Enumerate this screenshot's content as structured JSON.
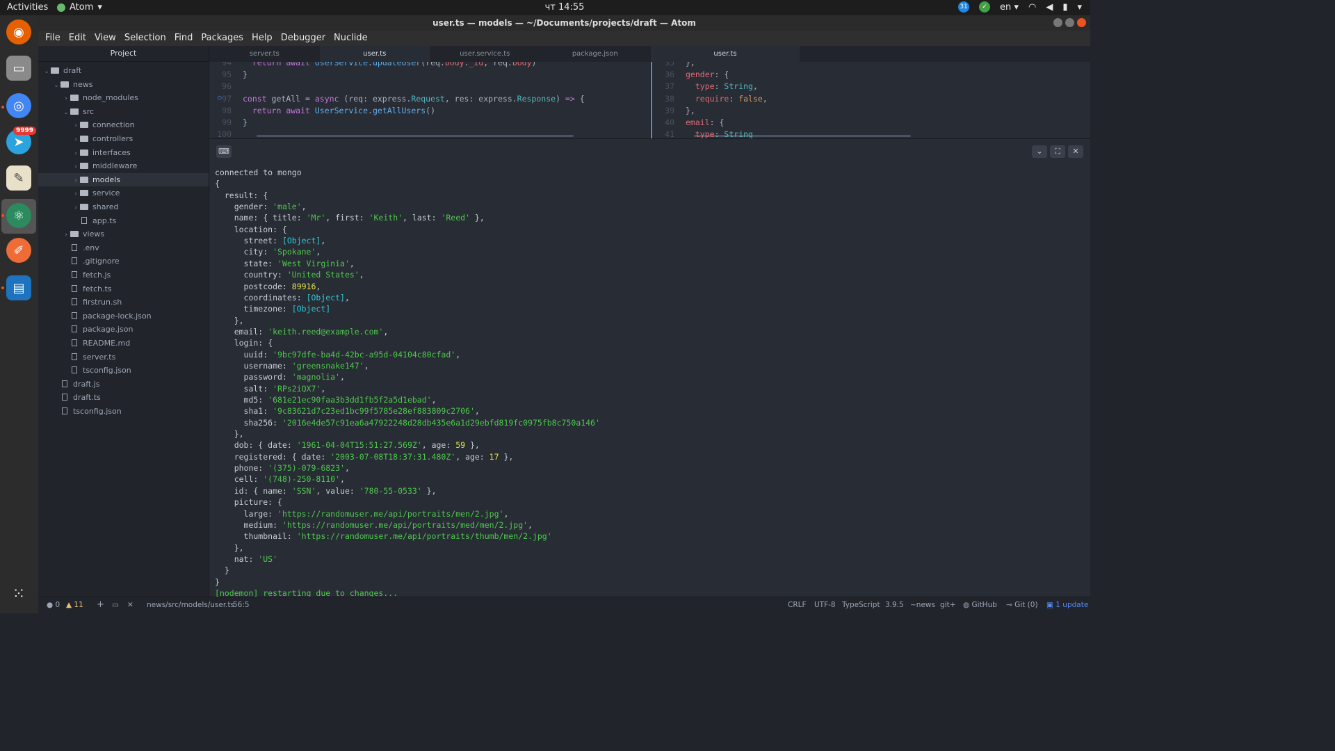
{
  "topbar": {
    "activities": "Activities",
    "app_name": "Atom",
    "app_arrow": "▾",
    "clock": "чт 14:55",
    "lang": "en",
    "lang_arrow": "▾",
    "notify_count": "31"
  },
  "window": {
    "title": "user.ts — models — ~/Documents/projects/draft — Atom"
  },
  "menu": [
    "File",
    "Edit",
    "View",
    "Selection",
    "Find",
    "Packages",
    "Help",
    "Debugger",
    "Nuclide"
  ],
  "dock": {
    "telegram_badge": "9999",
    "icons": [
      "firefox-icon",
      "files-icon",
      "chrome-icon",
      "telegram-icon",
      "text-editor-icon",
      "atom-icon",
      "postman-icon",
      "writer-icon",
      "app-grid-icon"
    ]
  },
  "tree": {
    "header": "Project",
    "rows": [
      {
        "label": "draft",
        "depth": 0,
        "kind": "folder",
        "open": true
      },
      {
        "label": "news",
        "depth": 1,
        "kind": "folder",
        "open": true
      },
      {
        "label": "node_modules",
        "depth": 2,
        "kind": "folder",
        "open": false
      },
      {
        "label": "src",
        "depth": 2,
        "kind": "folder",
        "open": true
      },
      {
        "label": "connection",
        "depth": 3,
        "kind": "folder",
        "open": false
      },
      {
        "label": "controllers",
        "depth": 3,
        "kind": "folder",
        "open": false
      },
      {
        "label": "interfaces",
        "depth": 3,
        "kind": "folder",
        "open": false
      },
      {
        "label": "middleware",
        "depth": 3,
        "kind": "folder",
        "open": false
      },
      {
        "label": "models",
        "depth": 3,
        "kind": "folder",
        "open": false,
        "selected": true
      },
      {
        "label": "service",
        "depth": 3,
        "kind": "folder",
        "open": false
      },
      {
        "label": "shared",
        "depth": 3,
        "kind": "folder",
        "open": false
      },
      {
        "label": "app.ts",
        "depth": 3,
        "kind": "file"
      },
      {
        "label": "views",
        "depth": 2,
        "kind": "folder",
        "open": false
      },
      {
        "label": ".env",
        "depth": 2,
        "kind": "file"
      },
      {
        "label": ".gitignore",
        "depth": 2,
        "kind": "file"
      },
      {
        "label": "fetch.js",
        "depth": 2,
        "kind": "file"
      },
      {
        "label": "fetch.ts",
        "depth": 2,
        "kind": "file"
      },
      {
        "label": "firstrun.sh",
        "depth": 2,
        "kind": "file"
      },
      {
        "label": "package-lock.json",
        "depth": 2,
        "kind": "file"
      },
      {
        "label": "package.json",
        "depth": 2,
        "kind": "file"
      },
      {
        "label": "README.md",
        "depth": 2,
        "kind": "file"
      },
      {
        "label": "server.ts",
        "depth": 2,
        "kind": "file"
      },
      {
        "label": "tsconfig.json",
        "depth": 2,
        "kind": "file"
      },
      {
        "label": "draft.js",
        "depth": 1,
        "kind": "file"
      },
      {
        "label": "draft.ts",
        "depth": 1,
        "kind": "file"
      },
      {
        "label": "tsconfig.json",
        "depth": 1,
        "kind": "file"
      }
    ]
  },
  "tabs_left": [
    {
      "label": "server.ts",
      "active": false
    },
    {
      "label": "user.ts",
      "active": true
    },
    {
      "label": "user.service.ts",
      "active": false
    },
    {
      "label": "package.json",
      "active": false
    }
  ],
  "tabs_right": [
    {
      "label": "user.ts",
      "active": true
    }
  ],
  "editor_left": [
    {
      "num": "94",
      "parts": [
        [
          "pl",
          "  "
        ],
        [
          "kw",
          "return await "
        ],
        [
          "fn",
          "UserService"
        ],
        [
          "pl",
          "."
        ],
        [
          "fn",
          "updateUser"
        ],
        [
          "pl",
          "(req."
        ],
        [
          "pr",
          "body"
        ],
        [
          "pl",
          "."
        ],
        [
          "pr",
          "_id"
        ],
        [
          "pl",
          ", req."
        ],
        [
          "pr",
          "body"
        ],
        [
          "pl",
          ")"
        ]
      ]
    },
    {
      "num": "95",
      "parts": [
        [
          "pl",
          "}"
        ]
      ]
    },
    {
      "num": "96",
      "parts": []
    },
    {
      "num": "97",
      "parts": [
        [
          "kw",
          "const "
        ],
        [
          "pl",
          "getAll = "
        ],
        [
          "kw",
          "async "
        ],
        [
          "pl",
          "(req: express."
        ],
        [
          "ty",
          "Request"
        ],
        [
          "pl",
          ", res: express."
        ],
        [
          "ty",
          "Response"
        ],
        [
          "pl",
          ") "
        ],
        [
          "kw",
          "=>"
        ],
        [
          "pl",
          " {"
        ]
      ]
    },
    {
      "num": "98",
      "parts": [
        [
          "pl",
          "  "
        ],
        [
          "kw",
          "return await "
        ],
        [
          "fn",
          "UserService"
        ],
        [
          "pl",
          "."
        ],
        [
          "fn",
          "getAllUsers"
        ],
        [
          "pl",
          "()"
        ]
      ]
    },
    {
      "num": "99",
      "parts": [
        [
          "pl",
          "}"
        ]
      ]
    },
    {
      "num": "100",
      "parts": []
    }
  ],
  "editor_right": [
    {
      "num": "35",
      "parts": [
        [
          "pl",
          "},"
        ]
      ]
    },
    {
      "num": "36",
      "parts": [
        [
          "pr",
          "gender"
        ],
        [
          "pl",
          ": {"
        ]
      ]
    },
    {
      "num": "37",
      "parts": [
        [
          "pl",
          "  "
        ],
        [
          "pr",
          "type"
        ],
        [
          "pl",
          ": "
        ],
        [
          "ty",
          "String"
        ],
        [
          "pl",
          ","
        ]
      ]
    },
    {
      "num": "38",
      "parts": [
        [
          "pl",
          "  "
        ],
        [
          "pr",
          "require"
        ],
        [
          "pl",
          ": "
        ],
        [
          "bo",
          "false"
        ],
        [
          "pl",
          ","
        ]
      ]
    },
    {
      "num": "39",
      "parts": [
        [
          "pl",
          "},"
        ]
      ]
    },
    {
      "num": "40",
      "parts": [
        [
          "pr",
          "email"
        ],
        [
          "pl",
          ": {"
        ]
      ]
    },
    {
      "num": "41",
      "parts": [
        [
          "pl",
          "  "
        ],
        [
          "pr",
          "type"
        ],
        [
          "pl",
          ": "
        ],
        [
          "ty",
          "String"
        ]
      ]
    }
  ],
  "terminal": [
    [
      [
        "p",
        "connected to mongo"
      ]
    ],
    [
      [
        "p",
        "{"
      ]
    ],
    [
      [
        "p",
        "  result: {"
      ]
    ],
    [
      [
        "p",
        "    gender: "
      ],
      [
        "s",
        "'male'"
      ],
      [
        "p",
        ","
      ]
    ],
    [
      [
        "p",
        "    name: { title: "
      ],
      [
        "s",
        "'Mr'"
      ],
      [
        "p",
        ", first: "
      ],
      [
        "s",
        "'Keith'"
      ],
      [
        "p",
        ", last: "
      ],
      [
        "s",
        "'Reed'"
      ],
      [
        "p",
        " },"
      ]
    ],
    [
      [
        "p",
        "    location: {"
      ]
    ],
    [
      [
        "p",
        "      street: "
      ],
      [
        "o",
        "[Object]"
      ],
      [
        "p",
        ","
      ]
    ],
    [
      [
        "p",
        "      city: "
      ],
      [
        "s",
        "'Spokane'"
      ],
      [
        "p",
        ","
      ]
    ],
    [
      [
        "p",
        "      state: "
      ],
      [
        "s",
        "'West Virginia'"
      ],
      [
        "p",
        ","
      ]
    ],
    [
      [
        "p",
        "      country: "
      ],
      [
        "s",
        "'United States'"
      ],
      [
        "p",
        ","
      ]
    ],
    [
      [
        "p",
        "      postcode: "
      ],
      [
        "n",
        "89916"
      ],
      [
        "p",
        ","
      ]
    ],
    [
      [
        "p",
        "      coordinates: "
      ],
      [
        "o",
        "[Object]"
      ],
      [
        "p",
        ","
      ]
    ],
    [
      [
        "p",
        "      timezone: "
      ],
      [
        "o",
        "[Object]"
      ]
    ],
    [
      [
        "p",
        "    },"
      ]
    ],
    [
      [
        "p",
        "    email: "
      ],
      [
        "s",
        "'keith.reed@example.com'"
      ],
      [
        "p",
        ","
      ]
    ],
    [
      [
        "p",
        "    login: {"
      ]
    ],
    [
      [
        "p",
        "      uuid: "
      ],
      [
        "s",
        "'9bc97dfe-ba4d-42bc-a95d-04104c80cfad'"
      ],
      [
        "p",
        ","
      ]
    ],
    [
      [
        "p",
        "      username: "
      ],
      [
        "s",
        "'greensnake147'"
      ],
      [
        "p",
        ","
      ]
    ],
    [
      [
        "p",
        "      password: "
      ],
      [
        "s",
        "'magnolia'"
      ],
      [
        "p",
        ","
      ]
    ],
    [
      [
        "p",
        "      salt: "
      ],
      [
        "s",
        "'RPs2iQX7'"
      ],
      [
        "p",
        ","
      ]
    ],
    [
      [
        "p",
        "      md5: "
      ],
      [
        "s",
        "'681e21ec90faa3b3dd1fb5f2a5d1ebad'"
      ],
      [
        "p",
        ","
      ]
    ],
    [
      [
        "p",
        "      sha1: "
      ],
      [
        "s",
        "'9c83621d7c23ed1bc99f5785e28ef883809c2706'"
      ],
      [
        "p",
        ","
      ]
    ],
    [
      [
        "p",
        "      sha256: "
      ],
      [
        "s",
        "'2016e4de57c91ea6a47922248d28db435e6a1d29ebfd819fc0975fb8c750a146'"
      ]
    ],
    [
      [
        "p",
        "    },"
      ]
    ],
    [
      [
        "p",
        "    dob: { date: "
      ],
      [
        "s",
        "'1961-04-04T15:51:27.569Z'"
      ],
      [
        "p",
        ", age: "
      ],
      [
        "n",
        "59"
      ],
      [
        "p",
        " },"
      ]
    ],
    [
      [
        "p",
        "    registered: { date: "
      ],
      [
        "s",
        "'2003-07-08T18:37:31.480Z'"
      ],
      [
        "p",
        ", age: "
      ],
      [
        "n",
        "17"
      ],
      [
        "p",
        " },"
      ]
    ],
    [
      [
        "p",
        "    phone: "
      ],
      [
        "s",
        "'(375)-079-6823'"
      ],
      [
        "p",
        ","
      ]
    ],
    [
      [
        "p",
        "    cell: "
      ],
      [
        "s",
        "'(748)-250-8110'"
      ],
      [
        "p",
        ","
      ]
    ],
    [
      [
        "p",
        "    id: { name: "
      ],
      [
        "s",
        "'SSN'"
      ],
      [
        "p",
        ", value: "
      ],
      [
        "s",
        "'780-55-0533'"
      ],
      [
        "p",
        " },"
      ]
    ],
    [
      [
        "p",
        "    picture: {"
      ]
    ],
    [
      [
        "p",
        "      large: "
      ],
      [
        "s",
        "'https://randomuser.me/api/portraits/men/2.jpg'"
      ],
      [
        "p",
        ","
      ]
    ],
    [
      [
        "p",
        "      medium: "
      ],
      [
        "s",
        "'https://randomuser.me/api/portraits/med/men/2.jpg'"
      ],
      [
        "p",
        ","
      ]
    ],
    [
      [
        "p",
        "      thumbnail: "
      ],
      [
        "s",
        "'https://randomuser.me/api/portraits/thumb/men/2.jpg'"
      ]
    ],
    [
      [
        "p",
        "    },"
      ]
    ],
    [
      [
        "p",
        "    nat: "
      ],
      [
        "s",
        "'US'"
      ]
    ],
    [
      [
        "p",
        "  }"
      ]
    ],
    [
      [
        "p",
        "}"
      ]
    ],
    [
      [
        "s",
        "[nodemon] restarting due to changes..."
      ]
    ]
  ],
  "status": {
    "errors": "0",
    "warnings": "11",
    "path": "news/src/models/user.ts",
    "cursor": "56:5",
    "line_ending": "CRLF",
    "encoding": "UTF-8",
    "grammar": "TypeScript",
    "version": "3.9.5",
    "branch_dir": "~news",
    "git_plus": "git+",
    "github": "GitHub",
    "git": "Git (0)",
    "update": "1 update"
  },
  "colors": {
    "accent": "#568af2",
    "ubuntu_orange": "#e95420",
    "string_green": "#4ec94e",
    "number_yellow": "#e5e54c",
    "object_cyan": "#2fc7d8"
  }
}
